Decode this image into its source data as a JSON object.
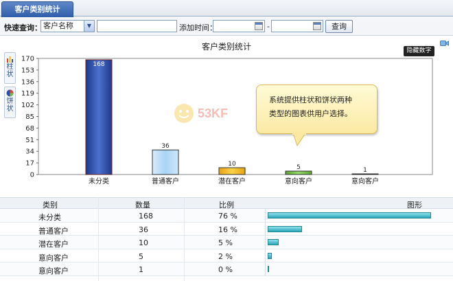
{
  "tab": {
    "label": "客户类别统计"
  },
  "query": {
    "label": "快速查询：",
    "select_value": "客户名称",
    "keyword_value": "",
    "time_label": "添加时间：",
    "date_from": "",
    "date_sep": "-",
    "date_to": "",
    "search_button": "查询"
  },
  "side_buttons": [
    {
      "label": "柱状",
      "icon": "bar-chart-icon"
    },
    {
      "label": "饼状",
      "icon": "pie-chart-icon"
    }
  ],
  "hide_numbers_button": "隐藏数字",
  "tooltip": {
    "line1": "系统提供柱状和饼状两种",
    "line2": "类型的图表供用户选择。"
  },
  "watermark": {
    "text": "53KF"
  },
  "colors": {
    "tab": "#2f5da8",
    "bar_blue": "#2d4fa8",
    "bar_lightblue": "#a9d4f5",
    "bar_orange": "#f3b81d",
    "bar_green": "#76c043",
    "table_bar": "#2aa6b8"
  },
  "chart_data": {
    "type": "bar",
    "title": "客户类别统计",
    "categories": [
      "未分类",
      "普通客户",
      "潜在客户",
      "意向客户",
      "意向客户"
    ],
    "values": [
      168,
      36,
      10,
      5,
      1
    ],
    "yticks": [
      0,
      17,
      34,
      51,
      68,
      85,
      102,
      119,
      136,
      153,
      170
    ],
    "ylim": [
      0,
      170
    ],
    "grid": false
  },
  "table": {
    "headers": [
      "类别",
      "数量",
      "比例",
      "图形"
    ],
    "rows": [
      {
        "category": "未分类",
        "count": "168",
        "ratio": "76 %",
        "fraction": 0.76
      },
      {
        "category": "普通客户",
        "count": "36",
        "ratio": "16 %",
        "fraction": 0.16
      },
      {
        "category": "潜在客户",
        "count": "10",
        "ratio": "5 %",
        "fraction": 0.05
      },
      {
        "category": "意向客户",
        "count": "5",
        "ratio": "2 %",
        "fraction": 0.02
      },
      {
        "category": "意向客户",
        "count": "1",
        "ratio": "0 %",
        "fraction": 0.0
      }
    ]
  }
}
